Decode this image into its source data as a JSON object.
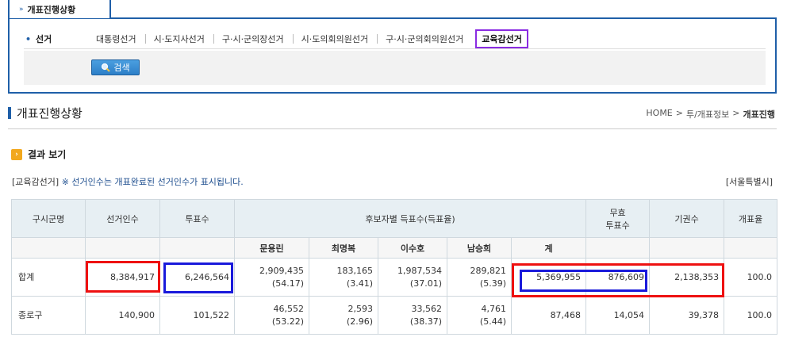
{
  "top_tab": {
    "label": "개표진행상황"
  },
  "elections": {
    "label": "선거",
    "items": [
      "대통령선거",
      "시·도지사선거",
      "구·시·군의장선거",
      "시·도의회의원선거",
      "구·시·군의회의원선거",
      "교육감선거"
    ],
    "selected": "교육감선거"
  },
  "search": {
    "label": "검색"
  },
  "page": {
    "title": "개표진행상황"
  },
  "breadcrumb": {
    "home": "HOME",
    "sep": ">",
    "level1": "투/개표정보",
    "current": "개표진행"
  },
  "section": {
    "title": "결과 보기"
  },
  "notice": {
    "tag": "[교육감선거]",
    "text": "※ 선거인수는 개표완료된 선거인수가 표시됩니다."
  },
  "region": "[서울특별시]",
  "table": {
    "headers": {
      "district": "구시군명",
      "electors": "선거인수",
      "votes": "투표수",
      "candidate_votes": "후보자별 득표수(득표율)",
      "invalid_line1": "무효",
      "invalid_line2": "투표수",
      "abstain": "기권수",
      "count_rate": "개표율"
    },
    "candidates": [
      "문용린",
      "최명복",
      "이수호",
      "남승희",
      "계"
    ],
    "rows": [
      {
        "district": "합계",
        "electors": "8,384,917",
        "votes": "6,246,564",
        "c1": "2,909,435",
        "c1_pct": "(54.17)",
        "c2": "183,165",
        "c2_pct": "(3.41)",
        "c3": "1,987,534",
        "c3_pct": "(37.01)",
        "c4": "289,821",
        "c4_pct": "(5.39)",
        "total": "5,369,955",
        "invalid": "876,609",
        "abstain": "2,138,353",
        "rate": "100.0"
      },
      {
        "district": "종로구",
        "electors": "140,900",
        "votes": "101,522",
        "c1": "46,552",
        "c1_pct": "(53.22)",
        "c2": "2,593",
        "c2_pct": "(2.96)",
        "c3": "33,562",
        "c3_pct": "(38.37)",
        "c4": "4,761",
        "c4_pct": "(5.44)",
        "total": "87,468",
        "invalid": "14,054",
        "abstain": "39,378",
        "rate": "100.0"
      }
    ]
  },
  "colors": {
    "accent": "#1f5fa8",
    "selected_outline": "#8a2be2",
    "highlight_red": "#ee1111",
    "highlight_blue": "#1a1adb",
    "header_bg": "#e7eff3"
  }
}
